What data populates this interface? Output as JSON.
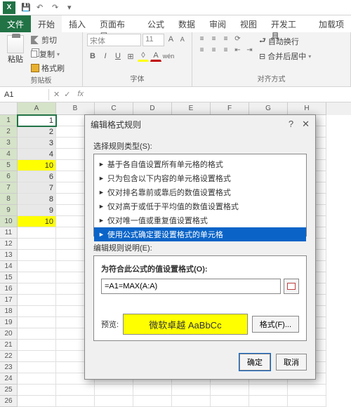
{
  "app": {
    "name": "X"
  },
  "qat": [
    "save",
    "undo",
    "redo",
    "touch"
  ],
  "tabs": {
    "file": "文件",
    "items": [
      "开始",
      "插入",
      "页面布局",
      "公式",
      "数据",
      "审阅",
      "视图",
      "开发工具",
      "加载项"
    ],
    "active": 0
  },
  "ribbon": {
    "clipboard": {
      "label": "剪贴板",
      "paste": "粘贴",
      "cut": "剪切",
      "copy": "复制",
      "painter": "格式刷"
    },
    "font": {
      "label": "字体",
      "name": "宋体",
      "size": "11"
    },
    "align": {
      "label": "对齐方式",
      "wrap": "自动换行",
      "merge": "合并后居中"
    }
  },
  "namebox": "A1",
  "fx": "fx",
  "columns": [
    "A",
    "B",
    "C",
    "D",
    "E",
    "F",
    "G",
    "H"
  ],
  "rows": 26,
  "rownums": [
    "1",
    "2",
    "3",
    "4",
    "5",
    "6",
    "7",
    "8",
    "9",
    "10",
    "11",
    "12",
    "13",
    "14",
    "15",
    "16",
    "17",
    "18",
    "19",
    "20",
    "21",
    "22",
    "23",
    "24",
    "25",
    "26"
  ],
  "data": {
    "A": [
      "1",
      "2",
      "3",
      "4",
      "10",
      "6",
      "7",
      "8",
      "9",
      "10"
    ]
  },
  "highlight_rows": [
    5,
    10
  ],
  "dialog": {
    "title": "编辑格式规则",
    "section1": "选择规则类型(S):",
    "rules": [
      "基于各自值设置所有单元格的格式",
      "只为包含以下内容的单元格设置格式",
      "仅对排名靠前或靠后的数值设置格式",
      "仅对高于或低于平均值的数值设置格式",
      "仅对唯一值或重复值设置格式",
      "使用公式确定要设置格式的单元格"
    ],
    "selected_rule": 5,
    "section2": "编辑规则说明(E):",
    "formula_label": "为符合此公式的值设置格式(O):",
    "formula": "=A1=MAX(A:A)",
    "preview_label": "预览:",
    "preview_text": "微软卓越  AaBbCc",
    "format_btn": "格式(F)...",
    "ok": "确定",
    "cancel": "取消"
  }
}
